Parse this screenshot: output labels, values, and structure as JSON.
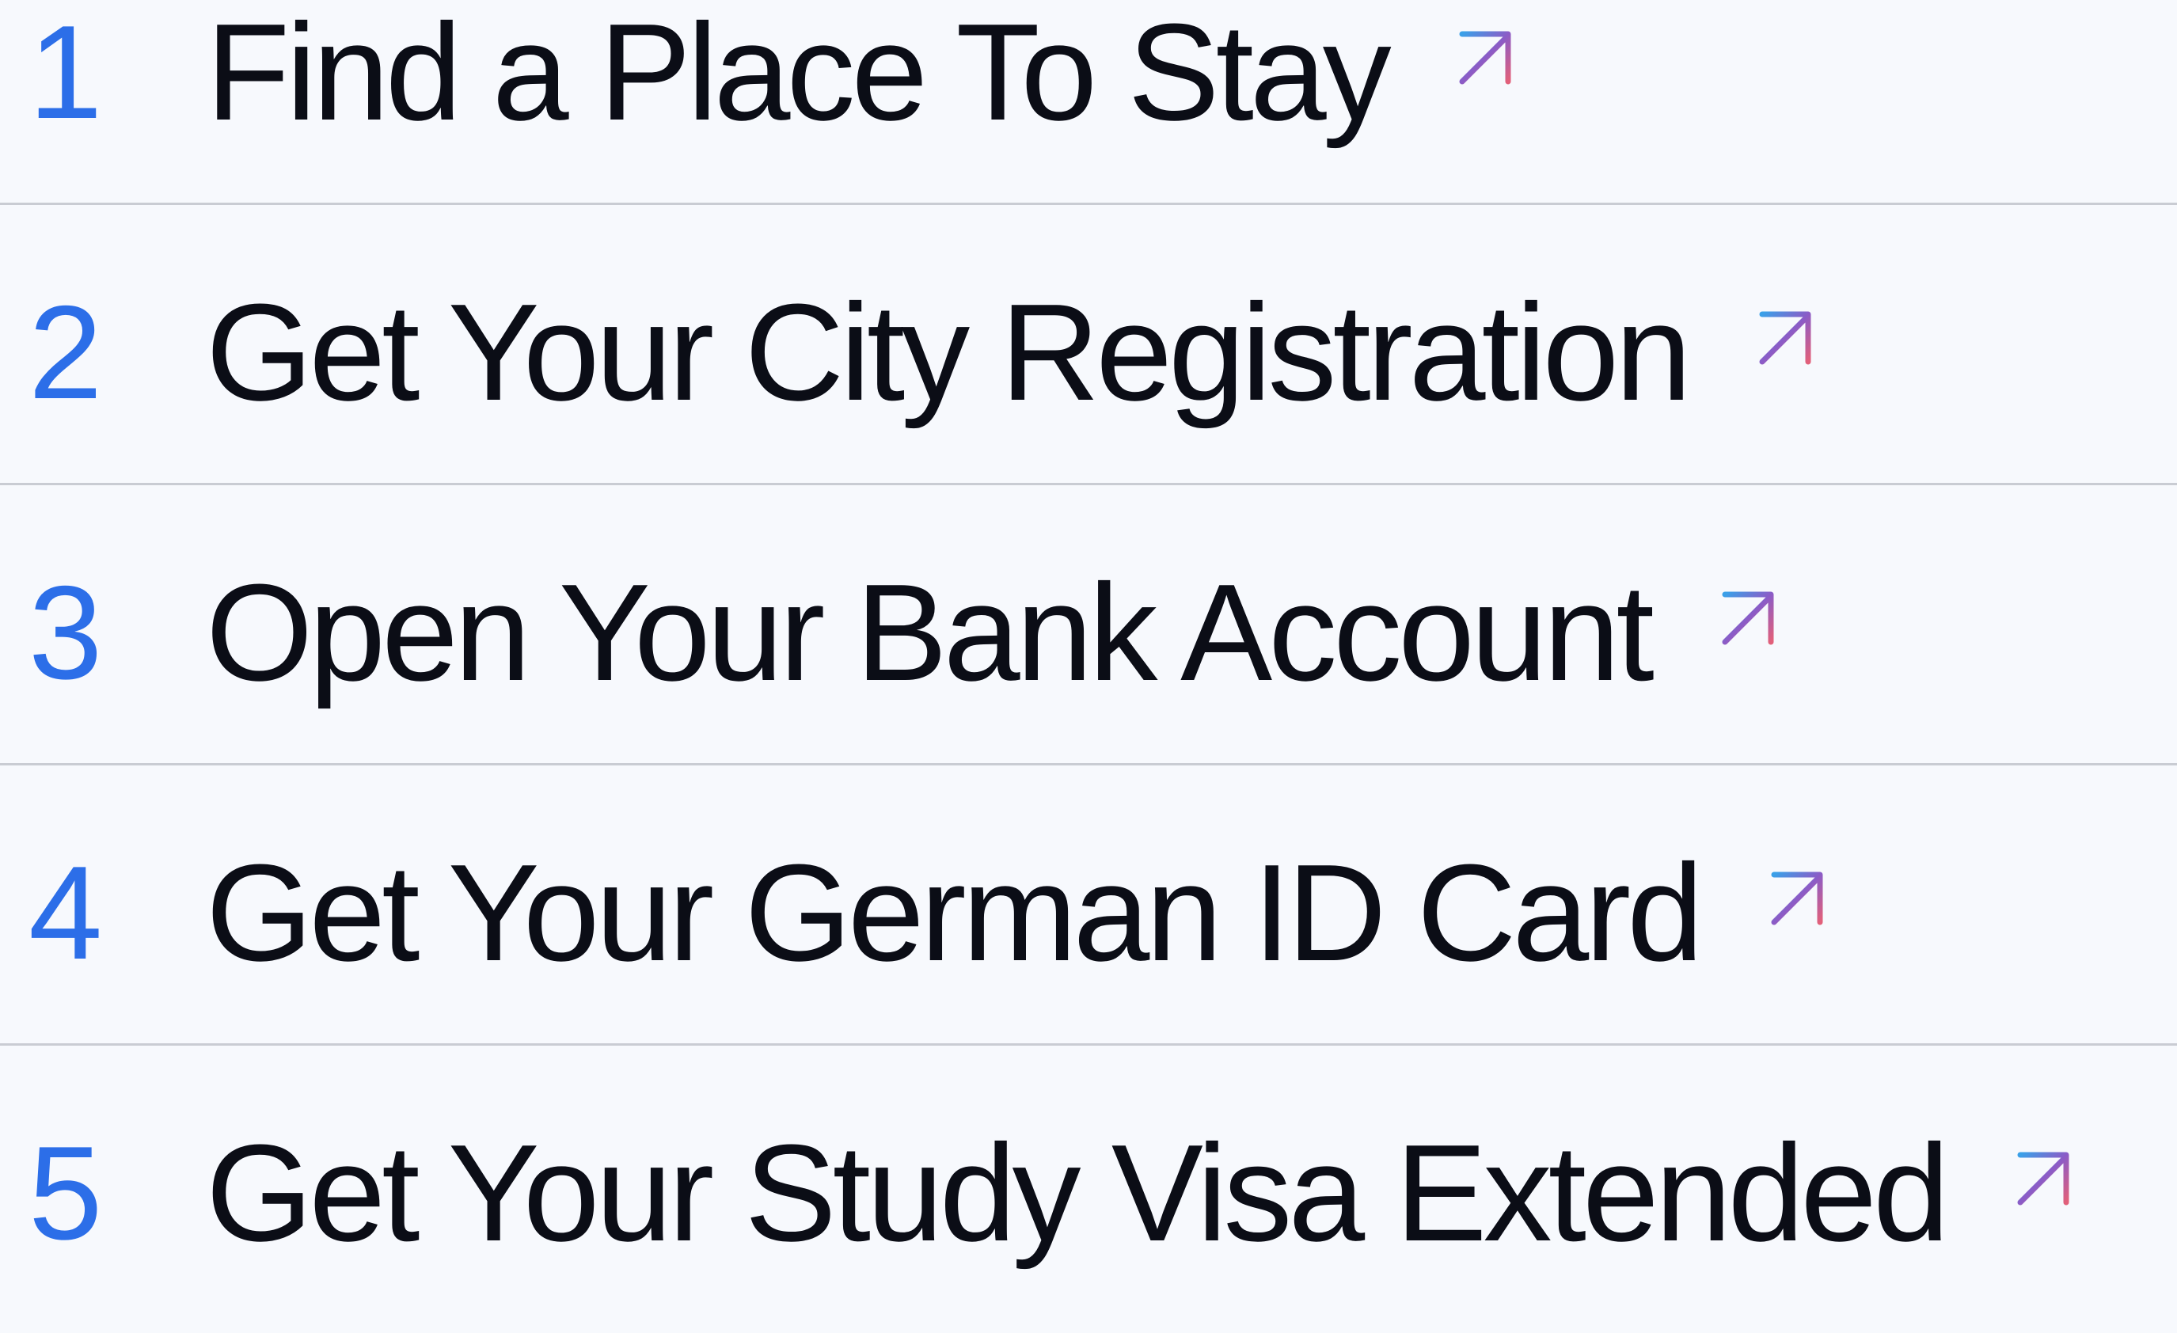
{
  "steps": [
    {
      "number": "1",
      "label": "Find a Place To Stay"
    },
    {
      "number": "2",
      "label": "Get Your City Registration"
    },
    {
      "number": "3",
      "label": "Open Your Bank Account"
    },
    {
      "number": "4",
      "label": "Get Your German ID Card"
    },
    {
      "number": "5",
      "label": "Get Your Study Visa Extended"
    }
  ],
  "icons": {
    "arrow": "arrow-up-right-icon"
  },
  "colors": {
    "number": "#2c6ee8",
    "text": "#0b0d16",
    "background": "#f7f9fd",
    "divider": "#c9ccd3",
    "arrow_gradient_start": "#3aa0e8",
    "arrow_gradient_mid": "#8b5cc7",
    "arrow_gradient_end": "#e2607a"
  }
}
